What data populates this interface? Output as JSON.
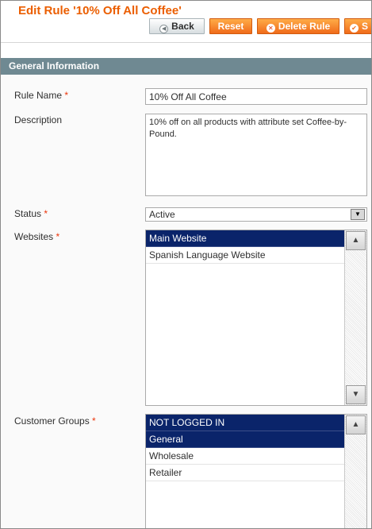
{
  "page": {
    "title": "Edit Rule '10% Off All Coffee'"
  },
  "toolbar": {
    "back_label": "Back",
    "reset_label": "Reset",
    "delete_label": "Delete Rule",
    "save_label": "S"
  },
  "section": {
    "title": "General Information"
  },
  "form": {
    "rule_name_label": "Rule Name",
    "rule_name_value": "10% Off All Coffee",
    "description_label": "Description",
    "description_value": "10% off on all products with attribute set Coffee-by-Pound.",
    "status_label": "Status",
    "status_value": "Active",
    "websites_label": "Websites",
    "websites_options": [
      "Main Website",
      "Spanish Language Website"
    ],
    "customer_groups_label": "Customer Groups",
    "customer_groups_options": [
      "NOT LOGGED IN",
      "General",
      "Wholesale",
      "Retailer"
    ],
    "required_marker": "*"
  },
  "colors": {
    "title": "#eb5e00",
    "section_header": "#6f8992",
    "selected_option": "#0a246a",
    "button_orange": "#f06b1a"
  }
}
